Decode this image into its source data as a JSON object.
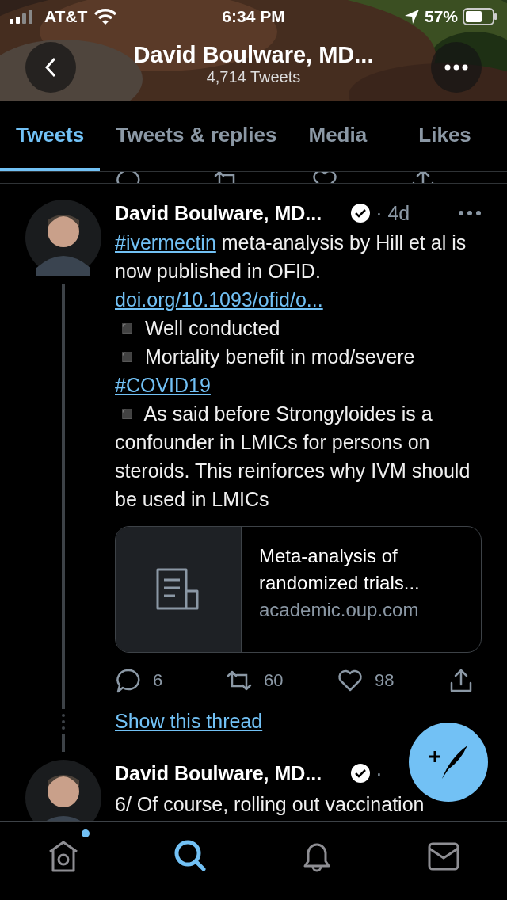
{
  "status_bar": {
    "carrier": "AT&T",
    "time": "6:34 PM",
    "battery": "57%"
  },
  "header": {
    "title": "David Boulware, MD...",
    "subtitle": "4,714 Tweets"
  },
  "tabs": [
    {
      "label": "Tweets",
      "selected": true
    },
    {
      "label": "Tweets & replies",
      "selected": false
    },
    {
      "label": "Media",
      "selected": false
    },
    {
      "label": "Likes",
      "selected": false
    }
  ],
  "tweets": [
    {
      "author": "David Boulware, MD...",
      "time": "· 4d",
      "body": [
        {
          "kind": "link",
          "text": "#ivermectin"
        },
        {
          "kind": "text",
          "text": " meta-analysis by Hill et al is now published in OFID.\n"
        },
        {
          "kind": "link",
          "text": "doi.org/10.1093/ofid/o..."
        },
        {
          "kind": "text",
          "text": "\n◾ Well conducted\n◾ Mortality benefit in mod/severe "
        },
        {
          "kind": "link",
          "text": "#COVID19"
        },
        {
          "kind": "text",
          "text": "\n◾  As said before Strongyloides is a confounder in LMICs for persons on steroids. This reinforces why IVM should be used in LMICs"
        }
      ],
      "card": {
        "title": "Meta-analysis of randomized trials...",
        "domain": "academic.oup.com"
      },
      "replies": "6",
      "retweets": "60",
      "likes": "98",
      "thread_link": "Show this thread"
    },
    {
      "author": "David Boulware, MD...",
      "time": "·",
      "body": [
        {
          "kind": "text",
          "text": "6/ Of course, rolling out vaccination"
        }
      ]
    }
  ],
  "nav": [
    {
      "kind": "home",
      "selected": false,
      "unread": true
    },
    {
      "kind": "search",
      "selected": true,
      "unread": false
    },
    {
      "kind": "notifications",
      "selected": false,
      "unread": false
    },
    {
      "kind": "messages",
      "selected": false,
      "unread": false
    }
  ]
}
